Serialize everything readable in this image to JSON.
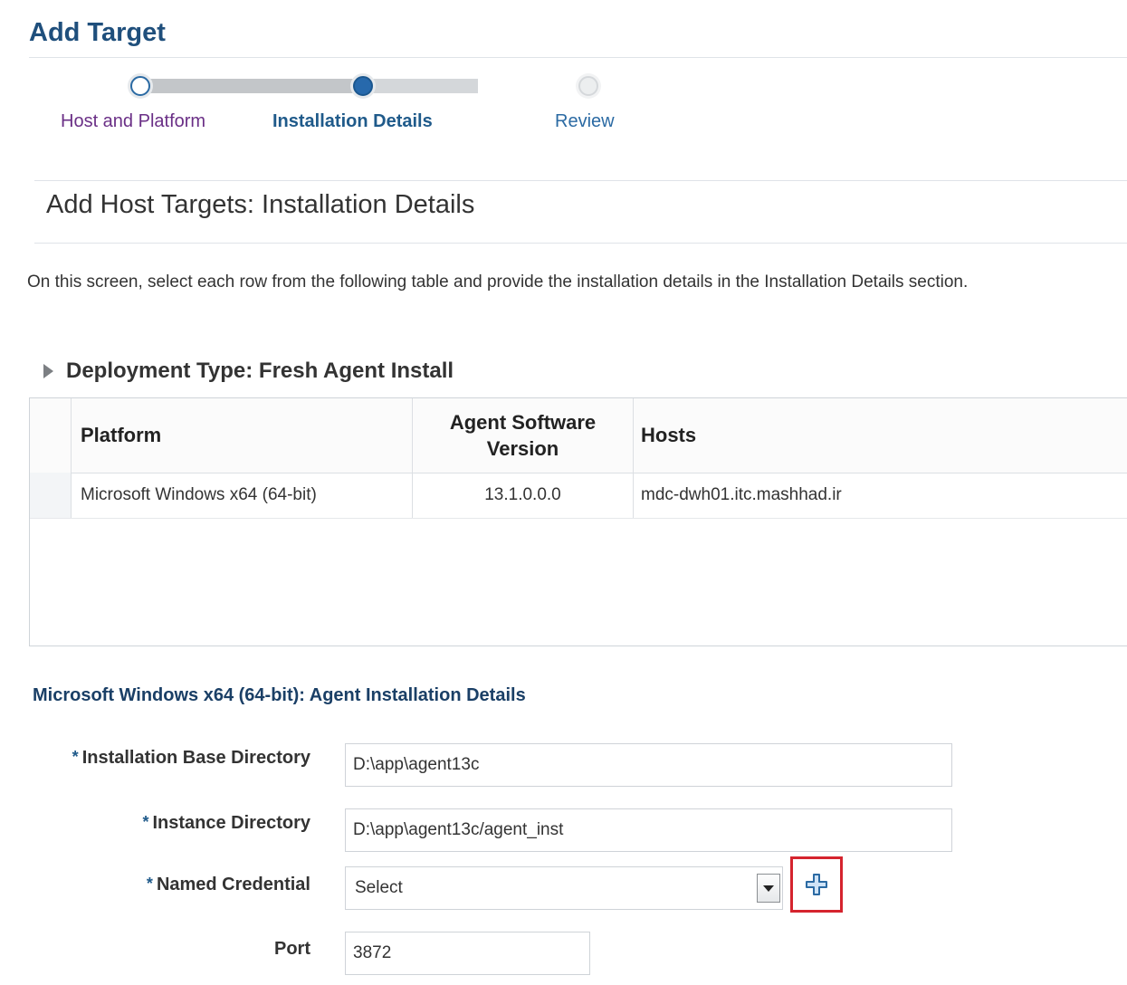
{
  "page": {
    "title": "Add Target"
  },
  "train": {
    "steps": [
      {
        "label": "Host and Platform",
        "state": "visited"
      },
      {
        "label": "Installation Details",
        "state": "current"
      },
      {
        "label": "Review",
        "state": "future"
      }
    ]
  },
  "section": {
    "title": "Add Host Targets: Installation Details",
    "instructions": "On this screen, select each row from the following table and provide the installation details in the Installation Details section."
  },
  "deployment": {
    "label": "Deployment Type: Fresh Agent Install"
  },
  "table": {
    "headers": {
      "platform": "Platform",
      "version": "Agent Software Version",
      "hosts": "Hosts"
    },
    "rows": [
      {
        "platform": "Microsoft Windows x64 (64-bit)",
        "version": "13.1.0.0.0",
        "hosts": "mdc-dwh01.itc.mashhad.ir"
      }
    ]
  },
  "details": {
    "title": "Microsoft Windows x64 (64-bit): Agent Installation Details",
    "required_marker": "*",
    "base_dir": {
      "label": "Installation Base Directory",
      "value": "D:\\app\\agent13c"
    },
    "instance_dir": {
      "label": "Instance Directory",
      "value": "D:\\app\\agent13c/agent_inst"
    },
    "named_credential": {
      "label": "Named Credential",
      "value": "Select"
    },
    "port": {
      "label": "Port",
      "value": "3872"
    }
  },
  "colors": {
    "accent": "#1f4f7c",
    "highlight_border": "#d5242e",
    "train_current": "#2769ac"
  }
}
